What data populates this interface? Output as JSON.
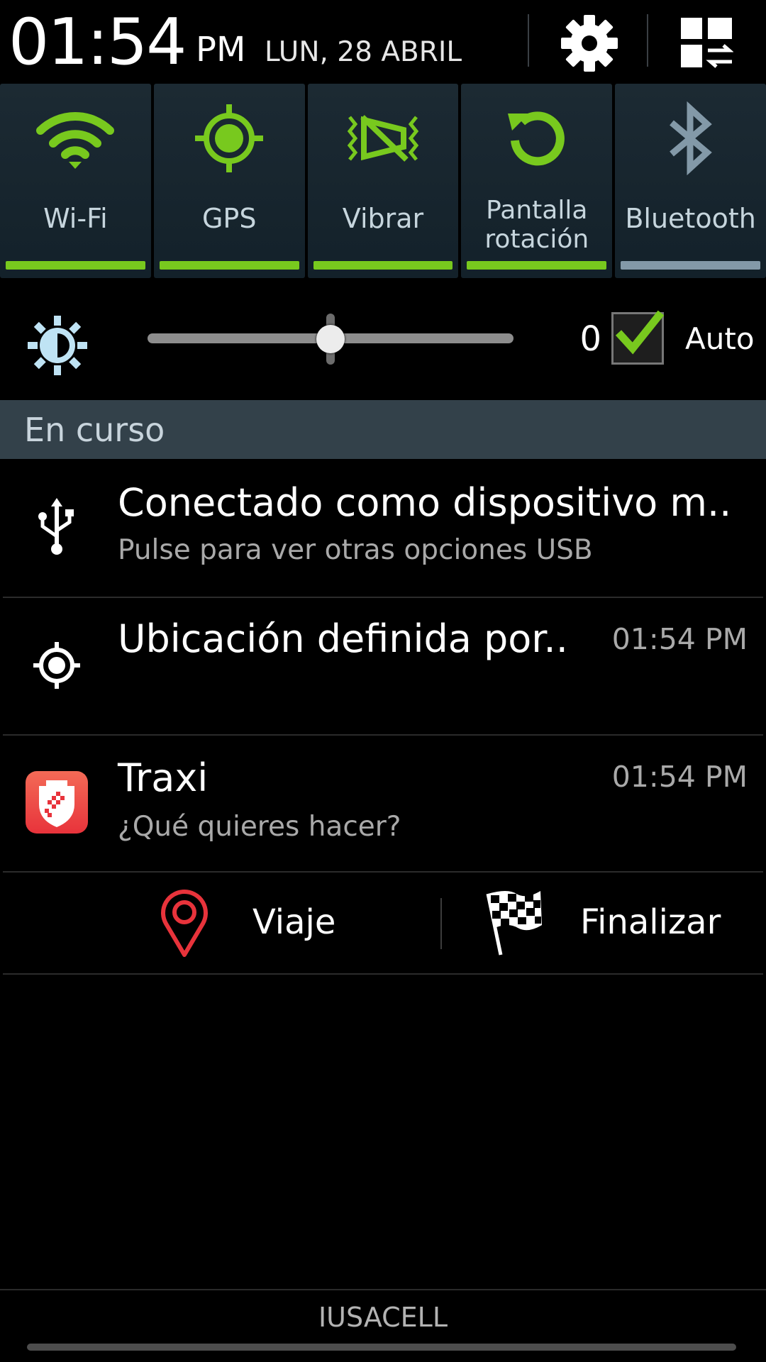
{
  "status": {
    "time": "01:54",
    "ampm": "PM",
    "date": "LUN, 28 ABRIL"
  },
  "toggles": [
    {
      "label": "Wi-Fi",
      "icon": "wifi-icon",
      "state": "on"
    },
    {
      "label": "GPS",
      "icon": "gps-icon",
      "state": "on"
    },
    {
      "label": "Vibrar",
      "icon": "vibrate-icon",
      "state": "on"
    },
    {
      "label_line1": "Pantalla",
      "label_line2": "rotación",
      "icon": "rotate-icon",
      "state": "on"
    },
    {
      "label": "Bluetooth",
      "icon": "bluetooth-icon",
      "state": "off"
    }
  ],
  "brightness": {
    "value": "0",
    "level": 0.5,
    "auto_label": "Auto",
    "auto_checked": true
  },
  "section": {
    "title": "En curso"
  },
  "notifications": [
    {
      "icon": "usb-icon",
      "title": "Conectado como dispositivo m..",
      "subtitle": "Pulse para ver otras opciones USB"
    },
    {
      "icon": "location-icon",
      "title": "Ubicación definida por..",
      "time": "01:54 PM"
    },
    {
      "icon": "traxi-app-icon",
      "title": "Traxi",
      "subtitle": "¿Qué quieres hacer?",
      "time": "01:54 PM"
    }
  ],
  "actions": {
    "trip_label": "Viaje",
    "finish_label": "Finalizar"
  },
  "carrier": "IUSACELL",
  "colors": {
    "accent_on": "#78c91e",
    "accent_off": "#8399a8",
    "toggle_bg": "#1c2a33",
    "section_bg": "#33414a",
    "pin_red": "#e8333b"
  }
}
